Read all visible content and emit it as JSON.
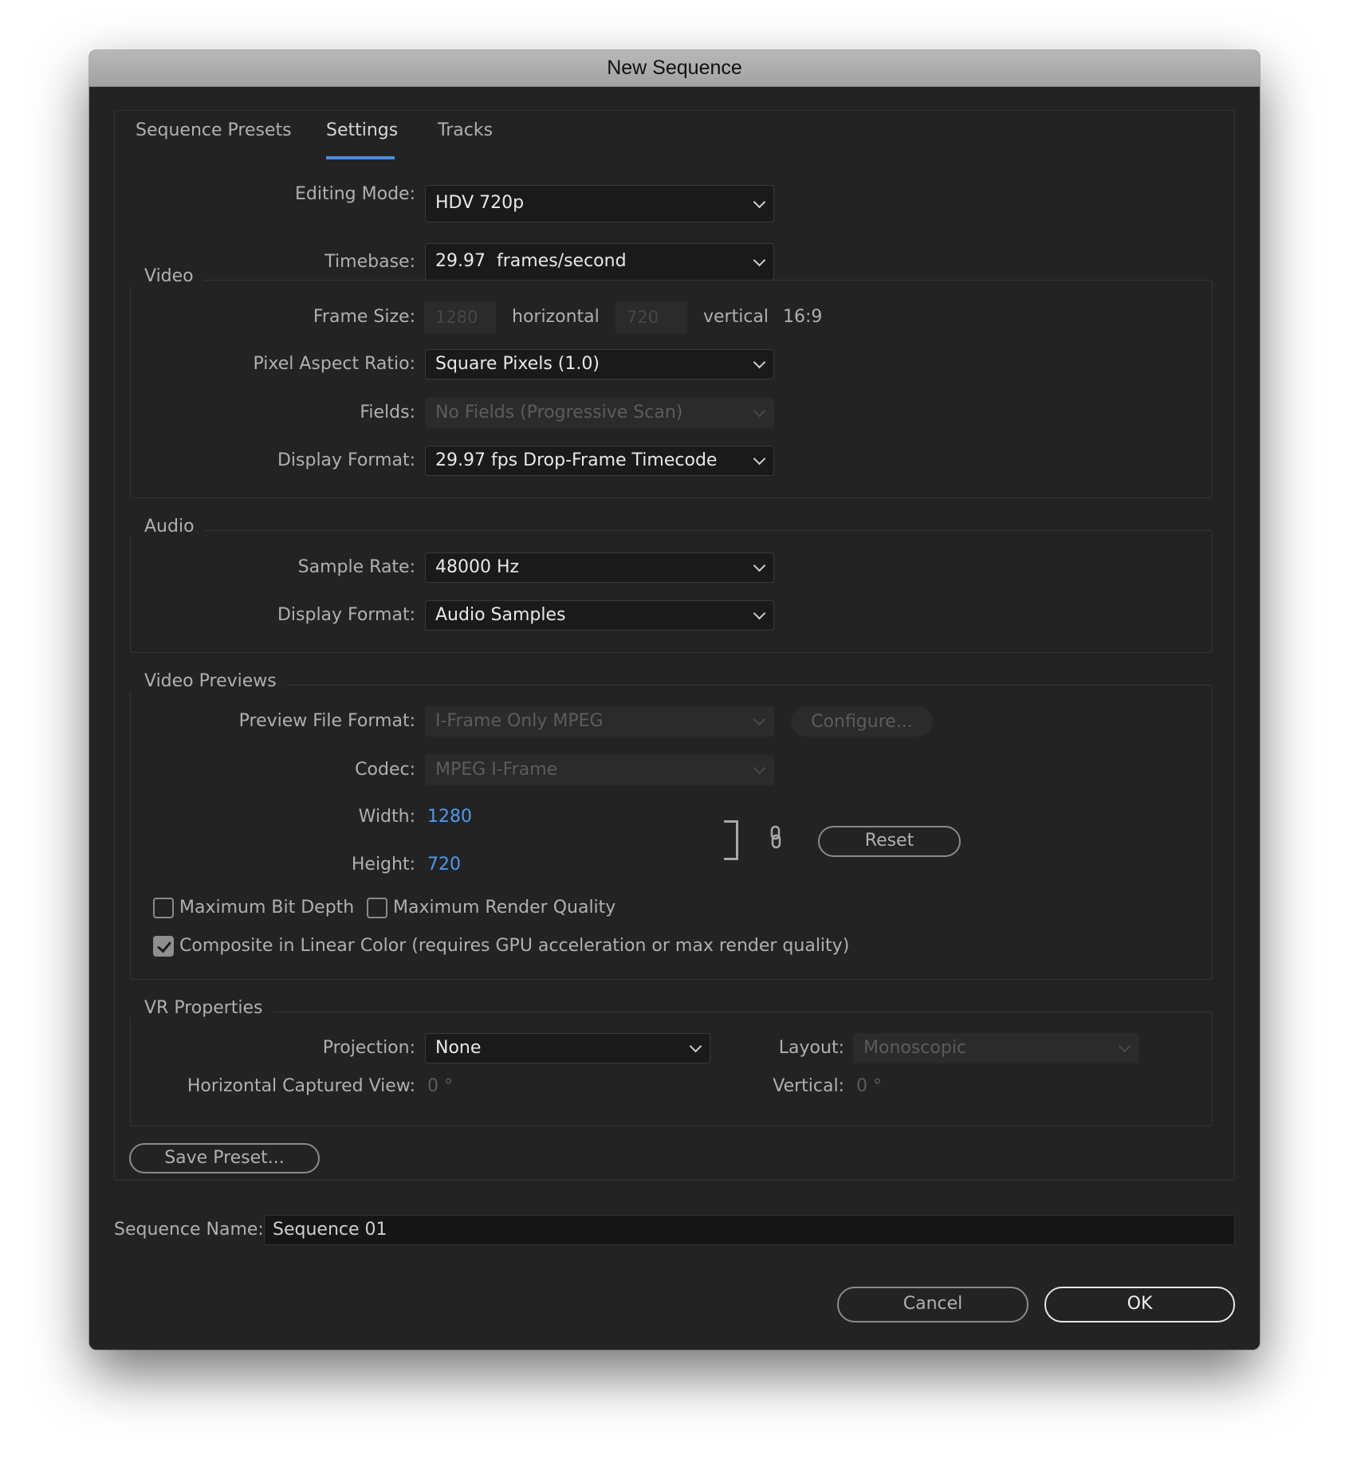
{
  "window": {
    "title": "New Sequence"
  },
  "tabs": [
    {
      "label": "Sequence Presets",
      "active": false
    },
    {
      "label": "Settings",
      "active": true
    },
    {
      "label": "Tracks",
      "active": false
    }
  ],
  "accent_color": "#4a90e2",
  "general": {
    "editing_mode": {
      "label": "Editing Mode:",
      "value": "HDV 720p"
    },
    "timebase": {
      "label": "Timebase:",
      "value": "29.97  frames/second"
    }
  },
  "video": {
    "title": "Video",
    "frame_size": {
      "label": "Frame Size:",
      "horizontal": "1280",
      "horizontal_label": "horizontal",
      "vertical": "720",
      "vertical_label": "vertical",
      "aspect": "16:9"
    },
    "pixel_aspect_ratio": {
      "label": "Pixel Aspect Ratio:",
      "value": "Square Pixels (1.0)"
    },
    "fields": {
      "label": "Fields:",
      "value": "No Fields (Progressive Scan)",
      "disabled": true
    },
    "display_format": {
      "label": "Display Format:",
      "value": "29.97 fps Drop-Frame Timecode"
    }
  },
  "audio": {
    "title": "Audio",
    "sample_rate": {
      "label": "Sample Rate:",
      "value": "48000 Hz"
    },
    "display_format": {
      "label": "Display Format:",
      "value": "Audio Samples"
    }
  },
  "video_previews": {
    "title": "Video Previews",
    "preview_file_format": {
      "label": "Preview File Format:",
      "value": "I-Frame Only MPEG",
      "disabled": true
    },
    "configure_label": "Configure...",
    "codec": {
      "label": "Codec:",
      "value": "MPEG I-Frame",
      "disabled": true
    },
    "width": {
      "label": "Width:",
      "value": "1280"
    },
    "height": {
      "label": "Height:",
      "value": "720"
    },
    "reset_label": "Reset",
    "max_bit_depth": {
      "label": "Maximum Bit Depth",
      "checked": false
    },
    "max_render_quality": {
      "label": "Maximum Render Quality",
      "checked": false
    },
    "composite_linear": {
      "label": "Composite in Linear Color (requires GPU acceleration or max render quality)",
      "checked": true
    }
  },
  "vr": {
    "title": "VR Properties",
    "projection": {
      "label": "Projection:",
      "value": "None"
    },
    "layout": {
      "label": "Layout:",
      "value": "Monoscopic",
      "disabled": true
    },
    "horizontal_captured_view": {
      "label": "Horizontal Captured View:",
      "value": "0 °"
    },
    "vertical": {
      "label": "Vertical:",
      "value": "0 °"
    }
  },
  "save_preset_label": "Save Preset...",
  "sequence_name": {
    "label": "Sequence Name:",
    "value": "Sequence 01"
  },
  "buttons": {
    "cancel": "Cancel",
    "ok": "OK"
  }
}
